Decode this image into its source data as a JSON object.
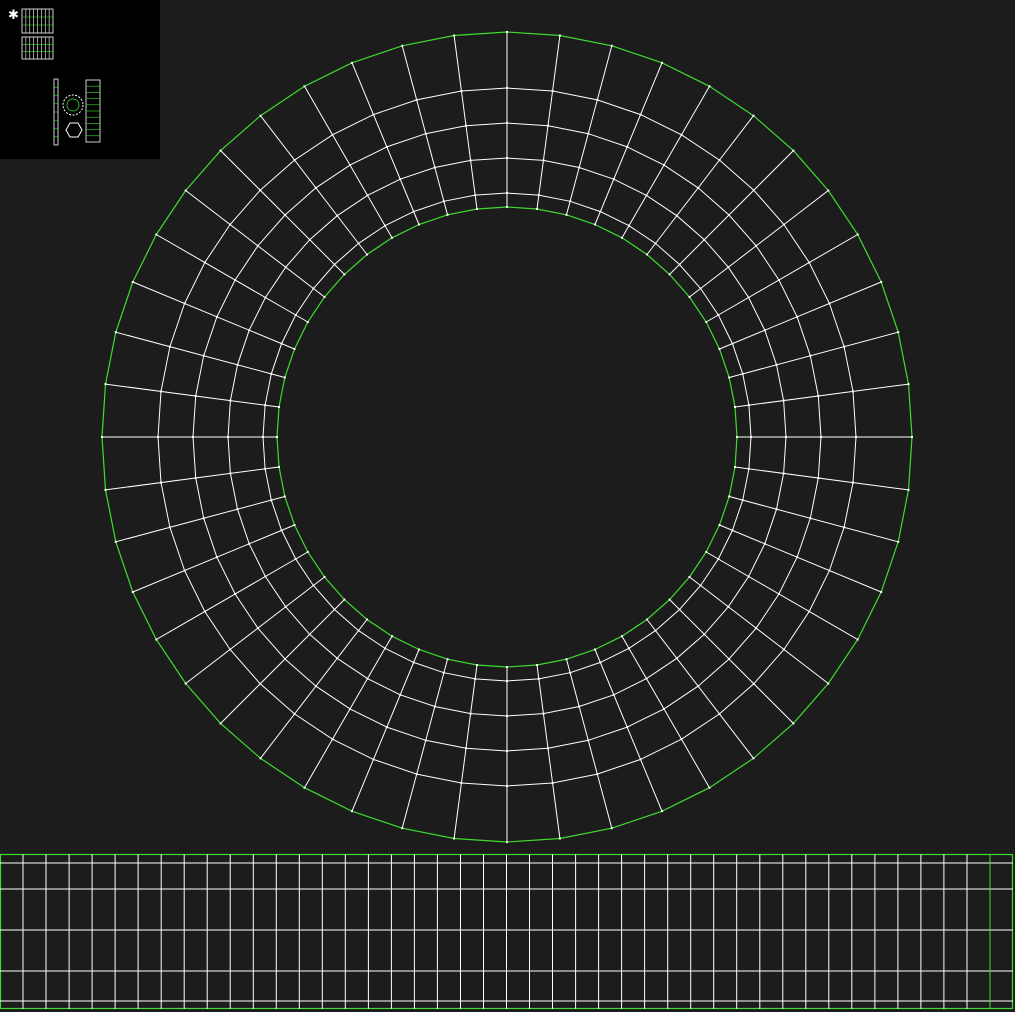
{
  "colors": {
    "background": "#1c1c1c",
    "thumbnail_background": "#000000",
    "boundary_edge": "#3ddc2f",
    "interior_edge": "#ffffff",
    "vertex": "#ffffff"
  },
  "ring_mesh": {
    "angular_segments": 48,
    "radial_rings": 6,
    "radius_fractions": [
      0,
      0.08,
      0.28,
      0.48,
      0.68,
      1.0
    ]
  },
  "strip_mesh": {
    "columns": 44,
    "rows": 4
  },
  "thumbnail": {
    "panel": "uv-overview"
  }
}
